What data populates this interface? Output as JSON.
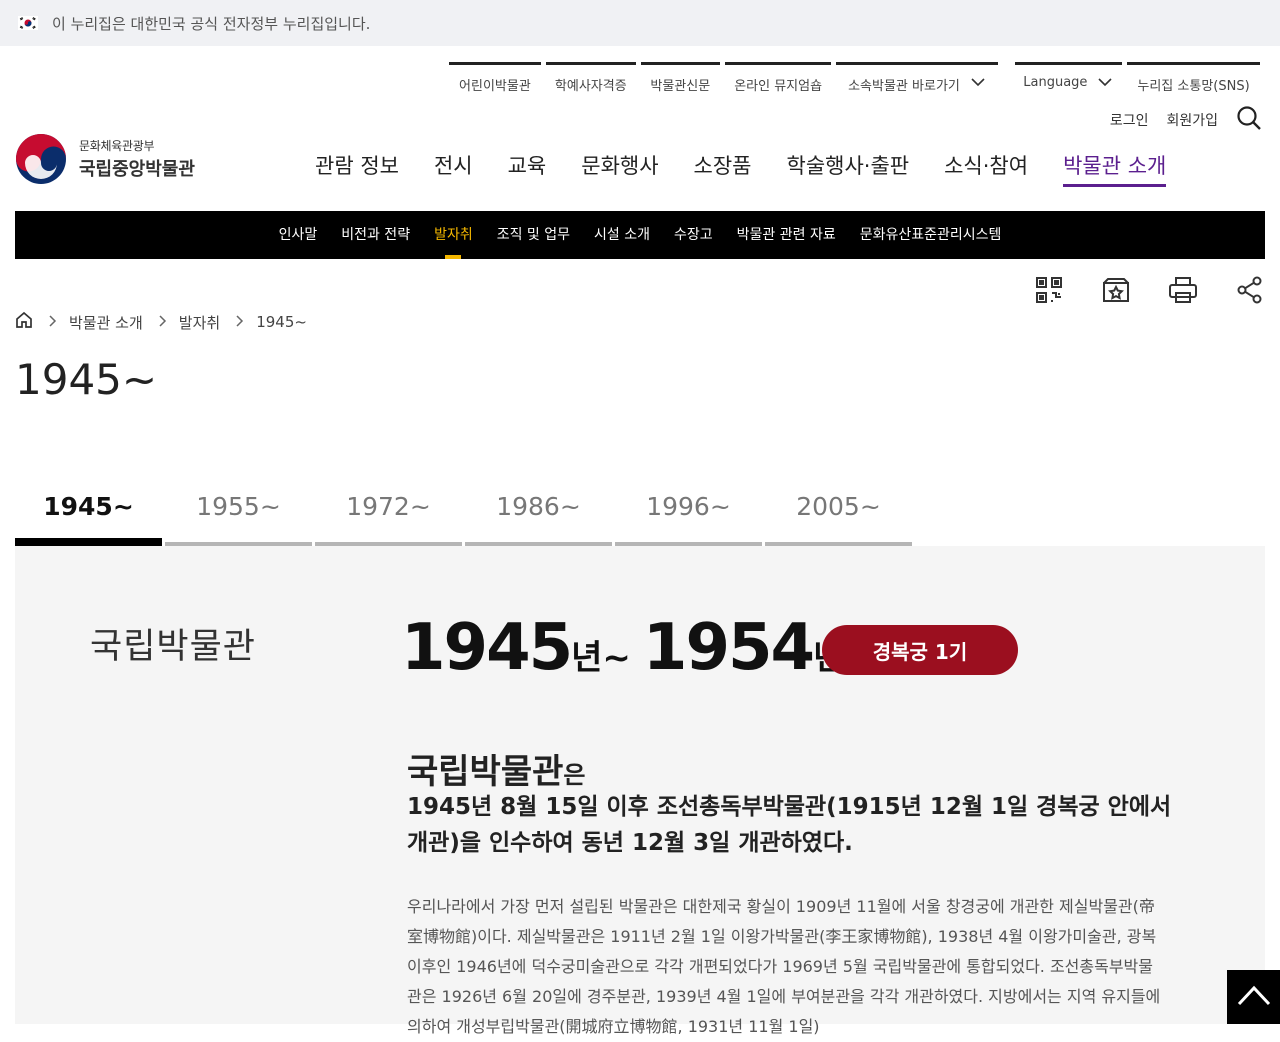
{
  "gov_banner": {
    "text": "이 누리집은 대한민국 공식 전자정부 누리집입니다."
  },
  "utility_nav": [
    {
      "label": "어린이박물관"
    },
    {
      "label": "학예사자격증"
    },
    {
      "label": "박물관신문"
    },
    {
      "label": "온라인 뮤지엄숍"
    },
    {
      "label": "소속박물관 바로가기"
    },
    {
      "label": "Language"
    },
    {
      "label": "누리집 소통망(SNS)"
    }
  ],
  "auth": {
    "login": "로그인",
    "signup": "회원가입"
  },
  "logo": {
    "ministry": "문화체육관광부",
    "name": "국립중앙박물관"
  },
  "gnb": [
    {
      "label": "관람 정보"
    },
    {
      "label": "전시"
    },
    {
      "label": "교육"
    },
    {
      "label": "문화행사"
    },
    {
      "label": "소장품"
    },
    {
      "label": "학술행사·출판"
    },
    {
      "label": "소식·참여"
    },
    {
      "label": "박물관 소개"
    }
  ],
  "sub_nav": [
    {
      "label": "인사말"
    },
    {
      "label": "비전과 전략"
    },
    {
      "label": "발자취"
    },
    {
      "label": "조직 및 업무"
    },
    {
      "label": "시설 소개"
    },
    {
      "label": "수장고"
    },
    {
      "label": "박물관 관련 자료"
    },
    {
      "label": "문화유산표준관리시스템"
    }
  ],
  "breadcrumb": [
    "박물관 소개",
    "발자취",
    "1945~"
  ],
  "page_title": "1945~",
  "tabs": [
    {
      "label": "1945~"
    },
    {
      "label": "1955~"
    },
    {
      "label": "1972~"
    },
    {
      "label": "1986~"
    },
    {
      "label": "1996~"
    },
    {
      "label": "2005~"
    }
  ],
  "era": {
    "stamp": "국립박물관",
    "start_year": "1945",
    "start_unit": "년~",
    "end_year": "1954",
    "end_unit": "년",
    "badge": "경복궁 1기",
    "heading_name": "국립박물관",
    "heading_particle": "은",
    "lead": "1945년 8월 15일 이후 조선총독부박물관(1915년 12월 1일 경복궁 안에서 개관)을 인수하여 동년 12월 3일 개관하였다.",
    "body": "우리나라에서 가장 먼저 설립된 박물관은 대한제국 황실이 1909년 11월에 서울 창경궁에 개관한 제실박물관(帝室博物館)이다. 제실박물관은 1911년 2월 1일 이왕가박물관(李王家博物館), 1938년 4월 이왕가미술관, 광복 이후인 1946년에 덕수궁미술관으로 각각 개편되었다가 1969년 5월 국립박물관에 통합되었다. 조선총독부박물관은 1926년 6월 20일에 경주분관, 1939년 4월 1일에 부여분관을 각각 개관하였다. 지방에서는 지역 유지들에 의하여 개성부립박물관(開城府立博物館, 1931년 11월 1일)"
  }
}
